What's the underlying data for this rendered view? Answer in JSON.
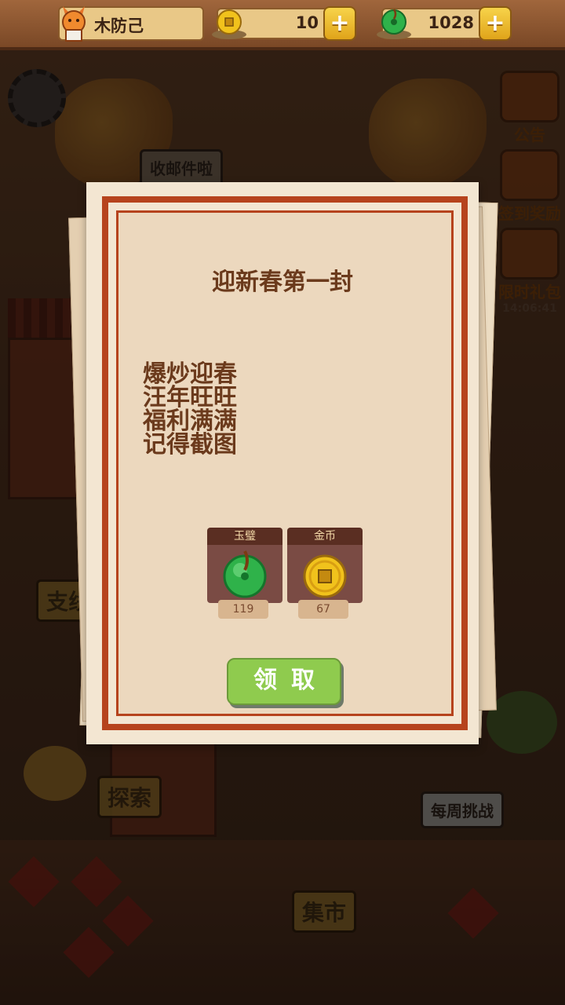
{
  "topbar": {
    "player_name": "木防己",
    "coins": "10",
    "jade": "1028"
  },
  "scene": {
    "mail_label": "收邮件啦",
    "notice_label": "公告",
    "signin_label": "签到奖励",
    "limited_gift_label": "限时礼包",
    "limited_gift_timer": "14:06:41",
    "explore_label": "探索",
    "weekly_challenge_label": "每周挑战",
    "market_label": "集市",
    "left_sign_label": "支线"
  },
  "letter": {
    "title": "迎新春第一封",
    "lines": [
      "爆炒迎春",
      "汪年旺旺",
      "福利满满",
      "记得截图"
    ],
    "rewards": [
      {
        "name": "玉璧",
        "count": "119",
        "icon": "jade-disc-icon",
        "color": "#2fb24a"
      },
      {
        "name": "金币",
        "count": "67",
        "icon": "gold-coin-icon",
        "color": "#f1c21c"
      }
    ],
    "claim_label": "领取"
  },
  "colors": {
    "frame": "#b6431d",
    "text": "#6b3a1c",
    "claim_button": "#8fcb4e"
  }
}
